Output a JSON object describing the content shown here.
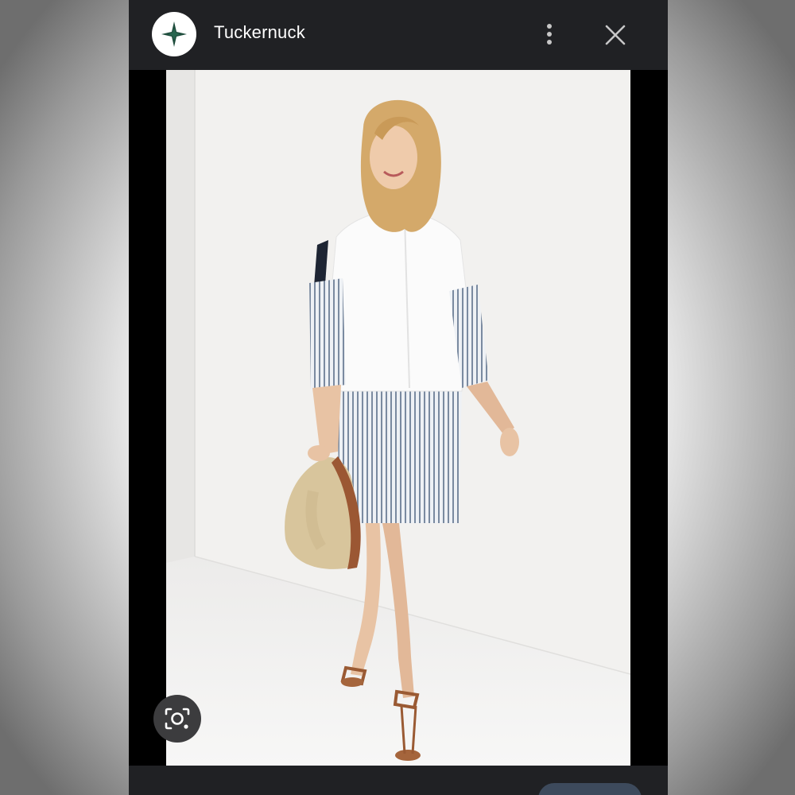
{
  "header": {
    "site_name": "Tuckernuck",
    "logo_icon": "tuckernuck-star-logo-icon",
    "more_icon": "more-vert-icon",
    "close_icon": "close-icon"
  },
  "image": {
    "subject": "product-photo"
  },
  "lens": {
    "icon": "lens-search-icon"
  },
  "colors": {
    "toolbar": "#202124",
    "logo_star": "#1f4d3d",
    "lens_button": "#3c3c3e",
    "action_pill": "#3d4a5c"
  }
}
